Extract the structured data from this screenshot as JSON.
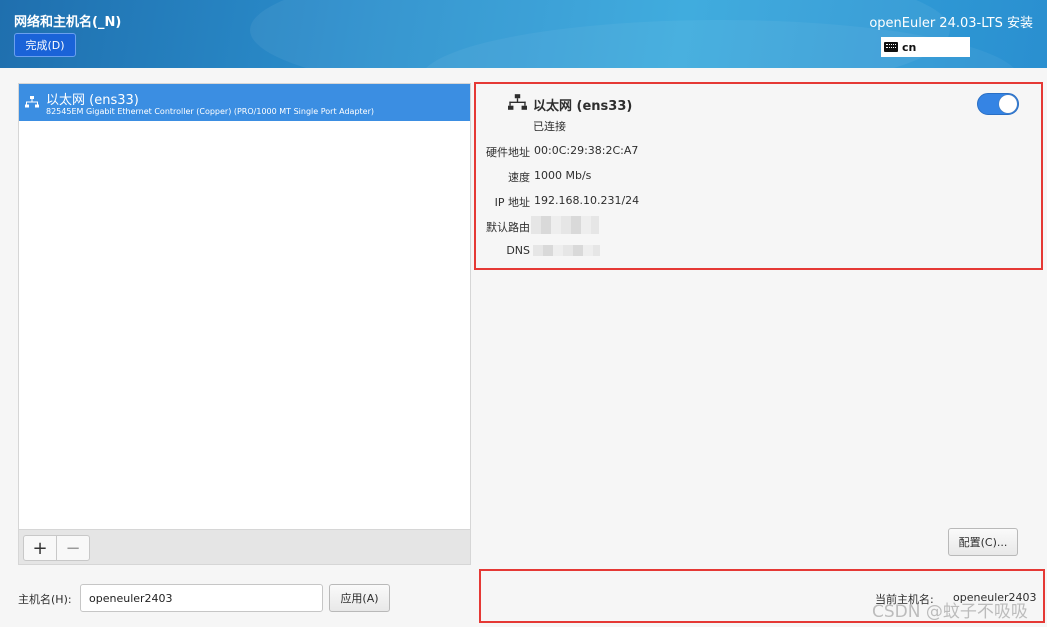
{
  "header": {
    "title": "网络和主机名(_N)",
    "done_label": "完成(D)",
    "product": "openEuler 24.03-LTS 安装",
    "keyboard_layout": "cn",
    "colors": {
      "gradient_start": "#1f6fae",
      "gradient_end": "#35a7dc",
      "done_button": "#1a63d8"
    }
  },
  "device_list": {
    "items": [
      {
        "name": "以太网 (ens33)",
        "description": "82545EM Gigabit Ethernet Controller (Copper) (PRO/1000 MT Single Port Adapter)",
        "selected": true
      }
    ],
    "add_label": "+",
    "remove_label": "−",
    "selected_color": "#3b8ee2"
  },
  "details": {
    "name": "以太网 (ens33)",
    "status": "已连接",
    "enabled": true,
    "rows": {
      "hw_label": "硬件地址",
      "hw_value": "00:0C:29:38:2C:A7",
      "speed_label": "速度",
      "speed_value": "1000 Mb/s",
      "ip_label": "IP 地址",
      "ip_value": "192.168.10.231/24",
      "gateway_label": "默认路由",
      "dns_label": "DNS"
    },
    "configure_label": "配置(C)..."
  },
  "hostname": {
    "label": "主机名(H):",
    "value": "openeuler2403",
    "apply_label": "应用(A)",
    "current_label": "当前主机名:",
    "current_value": "openeuler2403"
  },
  "watermark": "CSDN @蚊子不吸吸",
  "icons": {
    "network": "wired-network-icon",
    "keyboard": "keyboard-icon"
  }
}
